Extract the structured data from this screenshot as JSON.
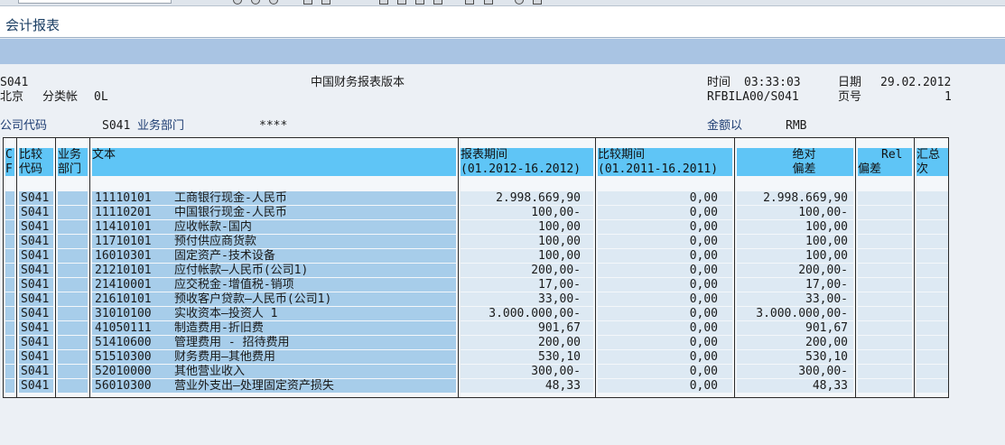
{
  "window": {
    "title": "会计报表"
  },
  "header": {
    "report_id": "S041",
    "report_title": "中国财务报表版本",
    "time_label": "时间",
    "time_value": "03:33:03",
    "date_label": "日期",
    "date_value": "29.02.2012",
    "city": "北京",
    "ledger_label": "分类帐",
    "ledger_value": "0L",
    "program": "RFBILA00/S041",
    "page_label": "页号",
    "page_value": "1",
    "company_label": "公司代码",
    "company_value": "S041",
    "dept_label": "业务部门",
    "dept_value": "****",
    "amount_label": "金额以",
    "currency": "RMB"
  },
  "columns": {
    "cf_top": "C",
    "cf_bottom": "F",
    "comp_top": "比较",
    "comp_bottom": "代码",
    "dept_top": "业务",
    "dept_bottom": "部门",
    "text": "文本",
    "report_period": "报表期间",
    "report_period_range": "(01.2012-16.2012)",
    "compare_period": "比较期间",
    "compare_period_range": "(01.2011-16.2011)",
    "abs_top": "绝对",
    "abs_bottom": "偏差",
    "rel_top": "Rel",
    "rel_bottom": "偏差",
    "sum_top": "汇总",
    "sum_bottom": "次"
  },
  "rows": [
    {
      "code": "S041",
      "account": "11110101",
      "text": "工商银行现金-人民币",
      "report": "2.998.669,90",
      "compare": "0,00",
      "abs": "2.998.669,90"
    },
    {
      "code": "S041",
      "account": "11110201",
      "text": "中国银行现金-人民币",
      "report": "100,00-",
      "compare": "0,00",
      "abs": "100,00-"
    },
    {
      "code": "S041",
      "account": "11410101",
      "text": "应收帐款-国内",
      "report": "100,00",
      "compare": "0,00",
      "abs": "100,00"
    },
    {
      "code": "S041",
      "account": "11710101",
      "text": "预付供应商货款",
      "report": "100,00",
      "compare": "0,00",
      "abs": "100,00"
    },
    {
      "code": "S041",
      "account": "16010301",
      "text": "固定资产-技术设备",
      "report": "100,00",
      "compare": "0,00",
      "abs": "100,00"
    },
    {
      "code": "S041",
      "account": "21210101",
      "text": "应付帐款—人民币(公司1)",
      "report": "200,00-",
      "compare": "0,00",
      "abs": "200,00-"
    },
    {
      "code": "S041",
      "account": "21410001",
      "text": "应交税金-增值税-销项",
      "report": "17,00-",
      "compare": "0,00",
      "abs": "17,00-"
    },
    {
      "code": "S041",
      "account": "21610101",
      "text": "预收客户贷款—人民币(公司1)",
      "report": "33,00-",
      "compare": "0,00",
      "abs": "33,00-"
    },
    {
      "code": "S041",
      "account": "31010100",
      "text": "实收资本—投资人 1",
      "report": "3.000.000,00-",
      "compare": "0,00",
      "abs": "3.000.000,00-"
    },
    {
      "code": "S041",
      "account": "41050111",
      "text": "制造费用-折旧费",
      "report": "901,67",
      "compare": "0,00",
      "abs": "901,67"
    },
    {
      "code": "S041",
      "account": "51410600",
      "text": "管理费用 - 招待费用",
      "report": "200,00",
      "compare": "0,00",
      "abs": "200,00"
    },
    {
      "code": "S041",
      "account": "51510300",
      "text": "财务费用—其他费用",
      "report": "530,10",
      "compare": "0,00",
      "abs": "530,10"
    },
    {
      "code": "S041",
      "account": "52010000",
      "text": "其他营业收入",
      "report": "300,00-",
      "compare": "0,00",
      "abs": "300,00-"
    },
    {
      "code": "S041",
      "account": "56010300",
      "text": "营业外支出—处理固定资产损失",
      "report": "48,33",
      "compare": "0,00",
      "abs": "48,33"
    }
  ]
}
